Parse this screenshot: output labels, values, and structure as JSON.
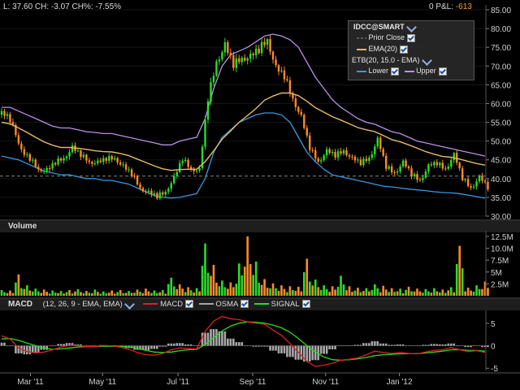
{
  "header": {
    "quote": "L: 37.60 CH: -3.07 CH%: -7.55%",
    "pnl_label": "0 P&L:",
    "pnl_value": "-613"
  },
  "legend": {
    "symbol": "IDCC@SMART",
    "prior_close": "Prior Close",
    "ema": "EMA(20)",
    "etb": "ETB(20, 15.0 - EMA)",
    "lower": "Lower",
    "upper": "Upper"
  },
  "volume_panel": {
    "title": "Volume"
  },
  "macd_panel": {
    "title": "MACD",
    "params": "(12, 26, 9 - EMA, EMA)",
    "macd": "MACD",
    "osma": "OSMA",
    "signal": "SIGNAL"
  },
  "colors": {
    "up": "#2bdc2b",
    "down": "#ff8a2a",
    "ema": "#e6b96a",
    "lower": "#3a9ae0",
    "upper": "#b890e6",
    "macd": "#e02020",
    "signal": "#22dd22",
    "osma": "#a8a8a8",
    "prior_close": "#888888"
  },
  "chart_data": [
    {
      "type": "candlestick",
      "title": "IDCC@SMART",
      "x_ticks": [
        "Mar '11",
        "May '11",
        "Jul '11",
        "Sep '11",
        "Nov '11",
        "Jan '12"
      ],
      "y_ticks": [
        "85.00",
        "80.00",
        "75.00",
        "70.00",
        "65.00",
        "60.00",
        "55.00",
        "50.00",
        "45.00",
        "40.00",
        "35.00",
        "30.00"
      ],
      "ylim": [
        30,
        85
      ],
      "prior_close": 40.67,
      "weekly_close": [
        57,
        55,
        47,
        45,
        43,
        42,
        44,
        46,
        48,
        46,
        45,
        44,
        45,
        46,
        43,
        41,
        38,
        36,
        35,
        37,
        40,
        45,
        43,
        42,
        61,
        72,
        75,
        70,
        73,
        72,
        74,
        78,
        69,
        67,
        62,
        56,
        48,
        45,
        47,
        46,
        48,
        45,
        44,
        46,
        50,
        43,
        42,
        44,
        41,
        40,
        43,
        44,
        43,
        46,
        40,
        38,
        40,
        37.6
      ],
      "ema20": [
        55,
        54.6,
        53.5,
        52.3,
        51,
        49.8,
        48.9,
        48.3,
        48.3,
        48.1,
        47.8,
        47.4,
        47.2,
        47.1,
        46.7,
        46.1,
        45.2,
        44.3,
        43.4,
        42.6,
        42.2,
        42.4,
        42.5,
        42.5,
        44.5,
        47.4,
        50.5,
        52.7,
        55,
        56.8,
        58.7,
        60.9,
        62,
        62.8,
        62.8,
        62.1,
        60.6,
        58.9,
        57.7,
        56.5,
        55.6,
        54.6,
        53.6,
        53,
        52.5,
        51.5,
        50.4,
        49.8,
        49,
        48.1,
        47.2,
        46.5,
        45.9,
        45.7,
        45.2,
        44.6,
        44,
        43.6
      ],
      "upper_band": [
        59,
        59,
        58,
        57,
        56,
        55,
        54,
        53.5,
        53.5,
        53,
        52.5,
        52.3,
        52,
        52,
        51.5,
        51,
        50.5,
        50,
        49.5,
        49,
        49,
        50,
        50.5,
        51,
        56,
        64,
        70,
        73,
        74,
        75,
        76.5,
        78,
        78.5,
        78,
        77,
        75,
        71,
        67,
        64,
        61,
        59,
        57.5,
        56,
        55,
        54.5,
        53.5,
        52.5,
        52,
        51,
        50,
        49.5,
        49,
        48.5,
        48,
        47.5,
        47,
        46.5,
        46
      ],
      "lower_band": [
        46,
        45.5,
        45,
        44,
        43,
        42,
        41.5,
        41,
        41,
        40.5,
        40,
        40,
        39.5,
        39.5,
        39,
        38.5,
        37.5,
        36.5,
        35.5,
        35,
        34.8,
        35,
        35.5,
        36,
        40,
        47,
        51,
        53,
        55,
        56,
        57,
        57.5,
        57.5,
        57,
        55,
        51,
        47,
        44.5,
        42.5,
        41,
        40.5,
        40,
        39.5,
        39,
        38.5,
        38,
        37.8,
        37.5,
        37.2,
        37,
        36.8,
        36.5,
        36.3,
        36.2,
        36,
        35.6,
        35.2,
        34.8
      ]
    },
    {
      "type": "bar",
      "title": "Volume",
      "y_ticks": [
        "12.5M",
        "10.0M",
        "7.5M",
        "5M",
        "2.5M"
      ],
      "ylim": [
        0,
        13000000
      ],
      "weekly_volume_millions": [
        1.2,
        1.1,
        4.5,
        2.2,
        1.5,
        1.3,
        1.1,
        1.0,
        1.2,
        1.4,
        1.0,
        1.3,
        0.9,
        1.1,
        1.2,
        1.0,
        1.3,
        1.5,
        1.1,
        1.2,
        3.8,
        2.4,
        1.8,
        1.6,
        11.0,
        6.5,
        3.2,
        2.8,
        6.8,
        12.5,
        7.2,
        3.5,
        2.6,
        2.2,
        2.0,
        1.9,
        7.8,
        3.4,
        2.2,
        2.0,
        4.2,
        2.0,
        1.7,
        1.6,
        2.4,
        2.1,
        1.6,
        1.5,
        1.9,
        1.5,
        1.4,
        1.6,
        1.3,
        1.8,
        10.5,
        1.7,
        2.2,
        3.0
      ],
      "weekly_up": [
        true,
        false,
        false,
        true,
        true,
        false,
        true,
        true,
        false,
        true,
        false,
        true,
        true,
        false,
        false,
        true,
        false,
        false,
        true,
        true,
        true,
        false,
        false,
        true,
        true,
        false,
        true,
        false,
        true,
        false,
        true,
        false,
        false,
        false,
        false,
        false,
        false,
        true,
        true,
        false,
        true,
        false,
        false,
        true,
        true,
        false,
        false,
        true,
        false,
        false,
        true,
        true,
        false,
        true,
        false,
        false,
        true,
        false
      ]
    },
    {
      "type": "line",
      "title": "MACD",
      "y_ticks": [
        "5",
        "0",
        "-5"
      ],
      "ylim": [
        -5.5,
        7.5
      ],
      "series": [
        {
          "name": "MACD",
          "values": [
            2.2,
            1.5,
            -0.5,
            -1.3,
            -1.6,
            -1.4,
            -0.9,
            -0.3,
            0.1,
            0,
            -0.2,
            -0.2,
            0,
            0,
            -0.3,
            -0.8,
            -1.5,
            -2.0,
            -2.1,
            -1.7,
            -0.9,
            -0.5,
            -0.6,
            -0.7,
            3.2,
            5.5,
            6.5,
            6.0,
            5.8,
            5.3,
            5.0,
            4.8,
            3.5,
            2.3,
            0.5,
            -1.5,
            -3.5,
            -4.6,
            -4.3,
            -3.9,
            -3.2,
            -3.0,
            -2.7,
            -2.0,
            -1.2,
            -1.5,
            -1.7,
            -1.5,
            -1.7,
            -1.8,
            -1.4,
            -1.0,
            -0.9,
            -0.4,
            -0.9,
            -1.3,
            -1.1,
            -1.5
          ]
        },
        {
          "name": "SIGNAL",
          "values": [
            1.5,
            1.6,
            1.2,
            0.6,
            0,
            -0.5,
            -0.8,
            -0.7,
            -0.5,
            -0.3,
            -0.2,
            -0.2,
            -0.15,
            -0.1,
            -0.15,
            -0.3,
            -0.6,
            -1.0,
            -1.4,
            -1.5,
            -1.4,
            -1.1,
            -0.9,
            -0.8,
            0.3,
            1.8,
            3.3,
            4.4,
            5.0,
            5.3,
            5.2,
            5.0,
            4.6,
            4.0,
            3.0,
            1.6,
            0,
            -1.4,
            -2.5,
            -3.1,
            -3.2,
            -3.1,
            -2.9,
            -2.6,
            -2.2,
            -2.0,
            -1.9,
            -1.8,
            -1.75,
            -1.75,
            -1.6,
            -1.4,
            -1.2,
            -0.9,
            -0.9,
            -1.0,
            -1.05,
            -1.2
          ]
        }
      ]
    }
  ]
}
